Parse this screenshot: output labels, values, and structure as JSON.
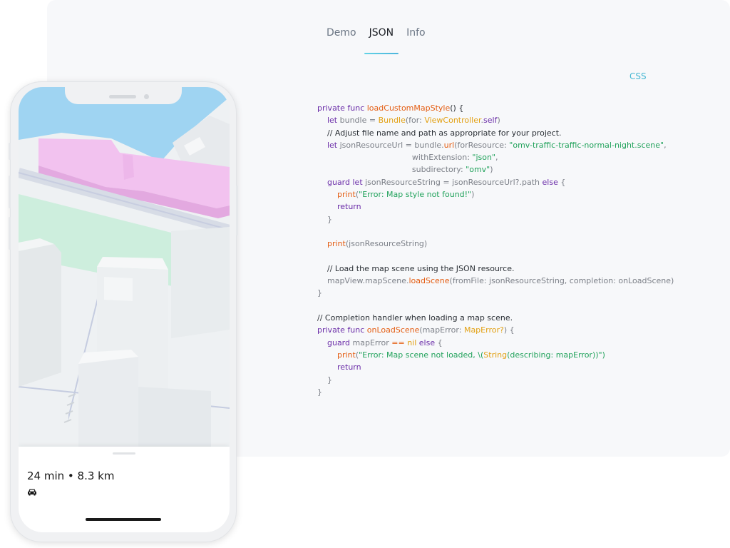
{
  "tabs": [
    {
      "label": "Demo",
      "active": false
    },
    {
      "label": "JSON",
      "active": true
    },
    {
      "label": "Info",
      "active": false
    }
  ],
  "css_link": "CSS",
  "code_lines": [
    [
      {
        "t": "private func ",
        "c": "kw"
      },
      {
        "t": "loadCustomMapStyle",
        "c": "fn"
      },
      {
        "t": "() {",
        "c": "cm"
      }
    ],
    [
      {
        "t": "    let ",
        "c": "kw"
      },
      {
        "t": "bundle = ",
        "c": "plain"
      },
      {
        "t": "Bundle",
        "c": "ty"
      },
      {
        "t": "(for: ",
        "c": "plain"
      },
      {
        "t": "ViewController",
        "c": "ty"
      },
      {
        "t": ".",
        "c": "plain"
      },
      {
        "t": "self",
        "c": "kw"
      },
      {
        "t": ")",
        "c": "plain"
      }
    ],
    [
      {
        "t": "    // Adjust file name and path as appropriate for your project.",
        "c": "cm"
      }
    ],
    [
      {
        "t": "    let ",
        "c": "kw"
      },
      {
        "t": "jsonResourceUrl = bundle.",
        "c": "plain"
      },
      {
        "t": "url",
        "c": "fn"
      },
      {
        "t": "(forResource: ",
        "c": "plain"
      },
      {
        "t": "\"omv-traffic-traffic-normal-night.scene\"",
        "c": "str"
      },
      {
        "t": ",",
        "c": "plain"
      }
    ],
    [
      {
        "t": "                                      withExtension: ",
        "c": "plain"
      },
      {
        "t": "\"json\"",
        "c": "str"
      },
      {
        "t": ",",
        "c": "plain"
      }
    ],
    [
      {
        "t": "                                      subdirectory: ",
        "c": "plain"
      },
      {
        "t": "\"omv\"",
        "c": "str"
      },
      {
        "t": ")",
        "c": "plain"
      }
    ],
    [
      {
        "t": "    guard let ",
        "c": "kw"
      },
      {
        "t": "jsonResourceString = jsonResourceUrl?.path ",
        "c": "plain"
      },
      {
        "t": "else",
        "c": "kw"
      },
      {
        "t": " {",
        "c": "plain"
      }
    ],
    [
      {
        "t": "        ",
        "c": "plain"
      },
      {
        "t": "print",
        "c": "fn"
      },
      {
        "t": "(",
        "c": "plain"
      },
      {
        "t": "\"Error: Map style not found!\"",
        "c": "str"
      },
      {
        "t": ")",
        "c": "plain"
      }
    ],
    [
      {
        "t": "        return",
        "c": "kw"
      }
    ],
    [
      {
        "t": "    }",
        "c": "plain"
      }
    ],
    [
      {
        "t": "",
        "c": "plain"
      }
    ],
    [
      {
        "t": "    ",
        "c": "plain"
      },
      {
        "t": "print",
        "c": "fn"
      },
      {
        "t": "(jsonResourceString)",
        "c": "plain"
      }
    ],
    [
      {
        "t": "",
        "c": "plain"
      }
    ],
    [
      {
        "t": "    // Load the map scene using the JSON resource.",
        "c": "cm"
      }
    ],
    [
      {
        "t": "    mapView.mapScene.",
        "c": "plain"
      },
      {
        "t": "loadScene",
        "c": "fn"
      },
      {
        "t": "(fromFile: jsonResourceString, completion: onLoadScene)",
        "c": "plain"
      }
    ],
    [
      {
        "t": "}",
        "c": "plain"
      }
    ],
    [
      {
        "t": "",
        "c": "plain"
      }
    ],
    [
      {
        "t": "// Completion handler when loading a map scene.",
        "c": "cm"
      }
    ],
    [
      {
        "t": "private func ",
        "c": "kw"
      },
      {
        "t": "onLoadScene",
        "c": "fn"
      },
      {
        "t": "(mapError: ",
        "c": "plain"
      },
      {
        "t": "MapError?",
        "c": "ty"
      },
      {
        "t": ") {",
        "c": "plain"
      }
    ],
    [
      {
        "t": "    guard ",
        "c": "kw"
      },
      {
        "t": "mapError ",
        "c": "plain"
      },
      {
        "t": "==",
        "c": "fn"
      },
      {
        "t": " ",
        "c": "plain"
      },
      {
        "t": "nil",
        "c": "ty"
      },
      {
        "t": " ",
        "c": "plain"
      },
      {
        "t": "else",
        "c": "kw"
      },
      {
        "t": " {",
        "c": "plain"
      }
    ],
    [
      {
        "t": "        ",
        "c": "plain"
      },
      {
        "t": "print",
        "c": "fn"
      },
      {
        "t": "(",
        "c": "plain"
      },
      {
        "t": "\"Error: Map scene not loaded, \\(",
        "c": "str"
      },
      {
        "t": "String",
        "c": "ty"
      },
      {
        "t": "(describing: mapError)",
        "c": "str"
      },
      {
        "t": ")\")",
        "c": "str"
      }
    ],
    [
      {
        "t": "        return",
        "c": "kw"
      }
    ],
    [
      {
        "t": "    }",
        "c": "plain"
      }
    ],
    [
      {
        "t": "}",
        "c": "plain"
      }
    ]
  ],
  "phone": {
    "route_summary": "24 min • 8.3 km",
    "transport_icon": "car-icon"
  },
  "colors": {
    "tab_underline": "#4cb5dc",
    "keyword": "#6a2ca8",
    "function": "#e45d12",
    "type": "#e2a012",
    "string": "#21a25b",
    "water": "#9fd4f2",
    "park": "#cdeedd",
    "highlighted_building": "#f2c2ef"
  }
}
